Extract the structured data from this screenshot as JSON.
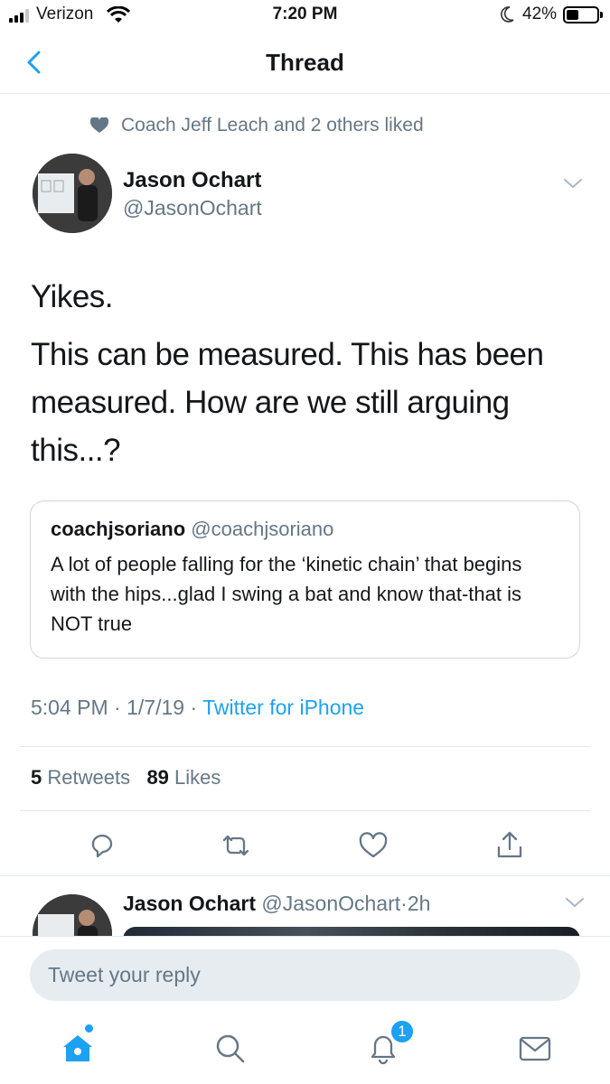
{
  "status_bar": {
    "carrier": "Verizon",
    "time": "7:20 PM",
    "battery": "42%",
    "battery_level": 0.42
  },
  "nav": {
    "title": "Thread"
  },
  "social_context": "Coach Jeff Leach and 2 others liked",
  "tweet": {
    "author_name": "Jason Ochart",
    "author_handle": "@JasonOchart",
    "paragraphs": [
      "Yikes.",
      "This can be measured. This has been measured. How are we still arguing this...?"
    ],
    "quote": {
      "name": "coachjsoriano",
      "handle": "@coachjsoriano",
      "text": "A lot of people falling for the ‘kinetic chain’ that begins with the hips...glad I swing a bat and know that-that is NOT true"
    },
    "time": "5:04 PM",
    "date": "1/7/19",
    "source": "Twitter for iPhone",
    "dot": "·",
    "retweets_count": "5",
    "retweets_label": "Retweets",
    "likes_count": "89",
    "likes_label": "Likes"
  },
  "next_tweet": {
    "author_name": "Jason Ochart",
    "author_handle": "@JasonOchart",
    "age": "2h"
  },
  "reply": {
    "placeholder": "Tweet your reply"
  },
  "tabbar": {
    "notifications_badge": "1"
  },
  "icons": {
    "back": "chevron-left-icon",
    "liked": "heart-icon",
    "actions": [
      "reply-icon",
      "retweet-icon",
      "like-icon",
      "share-icon"
    ],
    "tabs": [
      "home-icon",
      "search-icon",
      "bell-icon",
      "mail-icon"
    ]
  },
  "colors": {
    "accent": "#1da1f2",
    "secondary_text": "#657786",
    "primary_text": "#14171a",
    "divider": "#e1e8ed"
  }
}
